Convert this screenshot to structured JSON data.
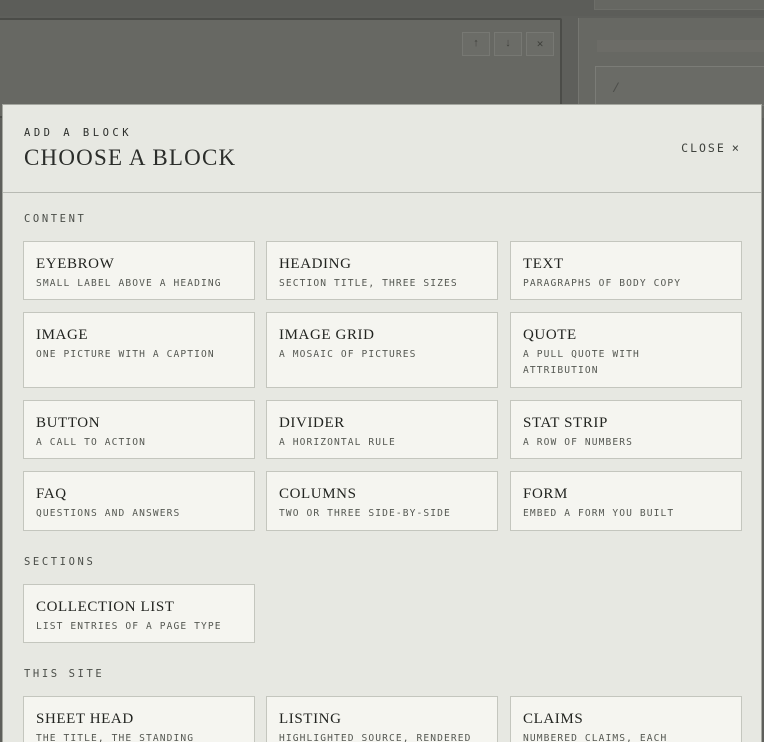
{
  "background": {
    "toolbar": [
      {
        "icon": "arrow-up-icon",
        "glyph": "↑"
      },
      {
        "icon": "arrow-down-icon",
        "glyph": "↓"
      },
      {
        "icon": "close-icon",
        "glyph": "✕"
      }
    ],
    "field_value": "/"
  },
  "modal": {
    "eyebrow": "ADD A BLOCK",
    "title": "CHOOSE A BLOCK",
    "close_label": "CLOSE",
    "close_glyph": "×"
  },
  "sections": {
    "content": {
      "label": "CONTENT",
      "blocks": [
        {
          "name": "EYEBROW",
          "desc": "SMALL LABEL ABOVE A HEADING"
        },
        {
          "name": "HEADING",
          "desc": "SECTION TITLE, THREE SIZES"
        },
        {
          "name": "TEXT",
          "desc": "PARAGRAPHS OF BODY COPY"
        },
        {
          "name": "IMAGE",
          "desc": "ONE PICTURE WITH A CAPTION"
        },
        {
          "name": "IMAGE GRID",
          "desc": "A MOSAIC OF PICTURES"
        },
        {
          "name": "QUOTE",
          "desc": "A PULL QUOTE WITH ATTRIBUTION"
        },
        {
          "name": "BUTTON",
          "desc": "A CALL TO ACTION"
        },
        {
          "name": "DIVIDER",
          "desc": "A HORIZONTAL RULE"
        },
        {
          "name": "STAT STRIP",
          "desc": "A ROW OF NUMBERS"
        },
        {
          "name": "FAQ",
          "desc": "QUESTIONS AND ANSWERS"
        },
        {
          "name": "COLUMNS",
          "desc": "TWO OR THREE SIDE-BY-SIDE"
        },
        {
          "name": "FORM",
          "desc": "EMBED A FORM YOU BUILT"
        }
      ]
    },
    "sections": {
      "label": "SECTIONS",
      "blocks": [
        {
          "name": "COLLECTION LIST",
          "desc": "LIST ENTRIES OF A PAGE TYPE"
        }
      ]
    },
    "this_site": {
      "label": "THIS SITE",
      "blocks": [
        {
          "name": "SHEET HEAD",
          "desc": "THE TITLE, THE STANDING"
        },
        {
          "name": "LISTING",
          "desc": "HIGHLIGHTED SOURCE, RENDERED"
        },
        {
          "name": "CLAIMS",
          "desc": "NUMBERED CLAIMS, EACH"
        }
      ]
    }
  }
}
